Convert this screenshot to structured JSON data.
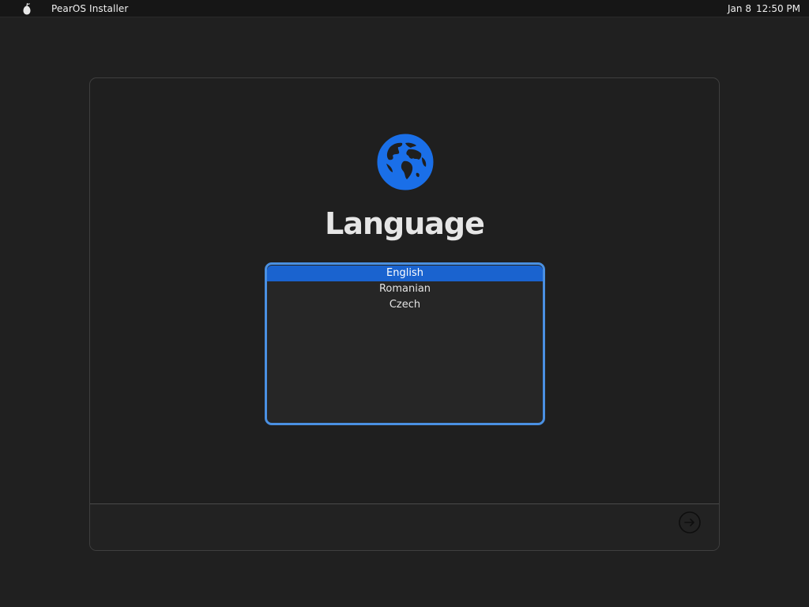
{
  "topbar": {
    "logo_icon": "pear-icon",
    "app_title": "PearOS Installer",
    "date": "Jan 8",
    "time": "12:50 PM"
  },
  "installer": {
    "icon": "globe-icon",
    "accent_color": "#1a6fe8",
    "heading": "Language",
    "languages": [
      {
        "label": "English",
        "selected": true
      },
      {
        "label": "Romanian",
        "selected": false
      },
      {
        "label": "Czech",
        "selected": false
      }
    ],
    "next_icon": "arrow-right-circle-icon"
  }
}
